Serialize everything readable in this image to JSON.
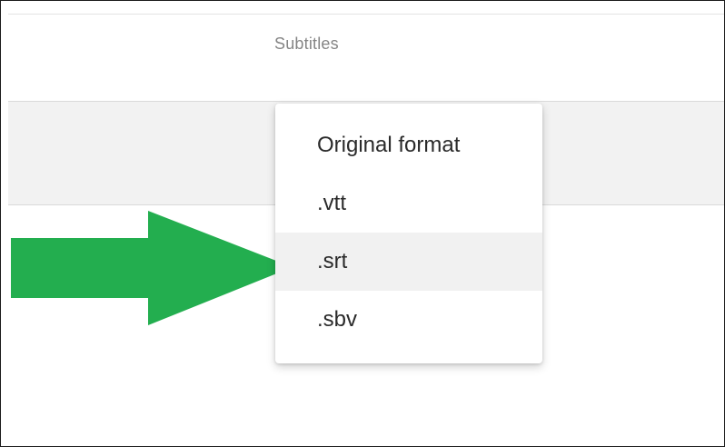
{
  "table": {
    "column_header": "Subtitles"
  },
  "format_menu": {
    "items": [
      {
        "label": "Original format"
      },
      {
        "label": ".vtt"
      },
      {
        "label": ".srt"
      },
      {
        "label": ".sbv"
      }
    ],
    "highlighted_index": 2
  },
  "colors": {
    "annotation_arrow": "#23ae4f",
    "highlight_background": "#f1f1f1",
    "row_background": "#f2f2f2"
  },
  "icons": {
    "annotation": "green-arrow-icon"
  }
}
